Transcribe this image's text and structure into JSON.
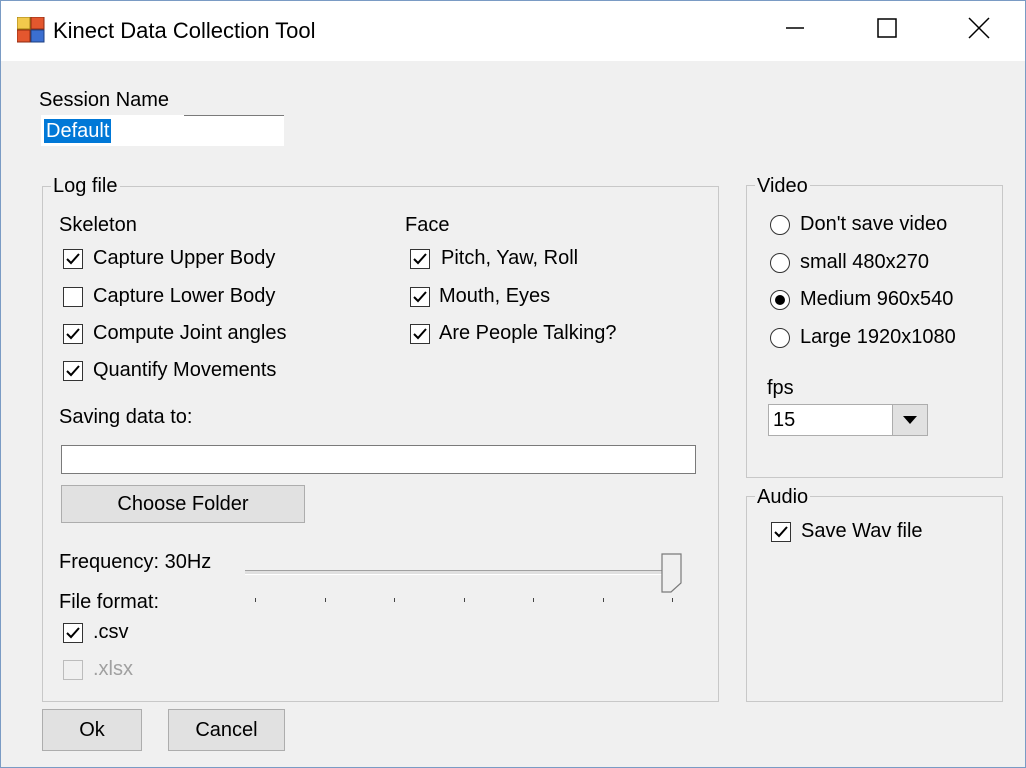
{
  "window": {
    "title": "Kinect Data Collection Tool",
    "icon": "app-icon",
    "controls": [
      "minimize-icon",
      "maximize-icon",
      "close-icon"
    ]
  },
  "session": {
    "label": "Session Name",
    "value": "Default"
  },
  "log_file": {
    "legend": "Log file",
    "skeleton": {
      "heading": "Skeleton",
      "items": [
        {
          "label": "Capture Upper Body",
          "checked": true
        },
        {
          "label": "Capture Lower Body",
          "checked": false
        },
        {
          "label": "Compute Joint angles",
          "checked": true
        },
        {
          "label": "Quantify Movements",
          "checked": true
        }
      ]
    },
    "face": {
      "heading": "Face",
      "items": [
        {
          "label": "Pitch, Yaw, Roll",
          "checked": true
        },
        {
          "label": "Mouth, Eyes",
          "checked": true
        },
        {
          "label": "Are People Talking?",
          "checked": true
        }
      ]
    },
    "saving_label": "Saving data to:",
    "saving_path": "",
    "choose_folder_label": "Choose Folder",
    "frequency_label": "Frequency: 30Hz",
    "frequency_slider_fraction": 1.0,
    "file_format_label": "File format:",
    "formats": [
      {
        "label": ".csv",
        "checked": true,
        "enabled": true
      },
      {
        "label": ".xlsx",
        "checked": false,
        "enabled": false
      }
    ]
  },
  "video": {
    "legend": "Video",
    "options": [
      {
        "label": "Don't save video",
        "selected": false
      },
      {
        "label": "small 480x270",
        "selected": false
      },
      {
        "label": "Medium 960x540",
        "selected": true
      },
      {
        "label": "Large 1920x1080",
        "selected": false
      }
    ],
    "fps_label": "fps",
    "fps_value": "15"
  },
  "audio": {
    "legend": "Audio",
    "save_wav_label": "Save Wav file",
    "save_wav_checked": true
  },
  "buttons": {
    "ok": "Ok",
    "cancel": "Cancel"
  }
}
